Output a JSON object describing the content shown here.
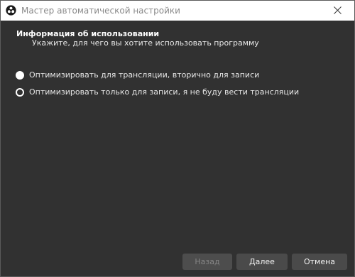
{
  "window": {
    "title": "Мастер автоматической настройки",
    "icon": "obs-logo-icon",
    "close_icon": "close-icon"
  },
  "header": {
    "title": "Информация об использовании",
    "subtitle": "Укажите, для чего вы хотите использовать программу"
  },
  "options": [
    {
      "label": "Оптимизировать для трансляции, вторично для записи",
      "selected": true
    },
    {
      "label": "Оптимизировать только для записи, я не буду вести трансляции",
      "selected": false
    }
  ],
  "buttons": {
    "back": {
      "label": "Назад",
      "enabled": false
    },
    "next": {
      "label": "Далее",
      "enabled": true
    },
    "cancel": {
      "label": "Отмена",
      "enabled": true
    }
  },
  "colors": {
    "background": "#313131",
    "titlebar": "#ffffff",
    "button": "#4a4a4a",
    "text": "#e6e6e6"
  }
}
